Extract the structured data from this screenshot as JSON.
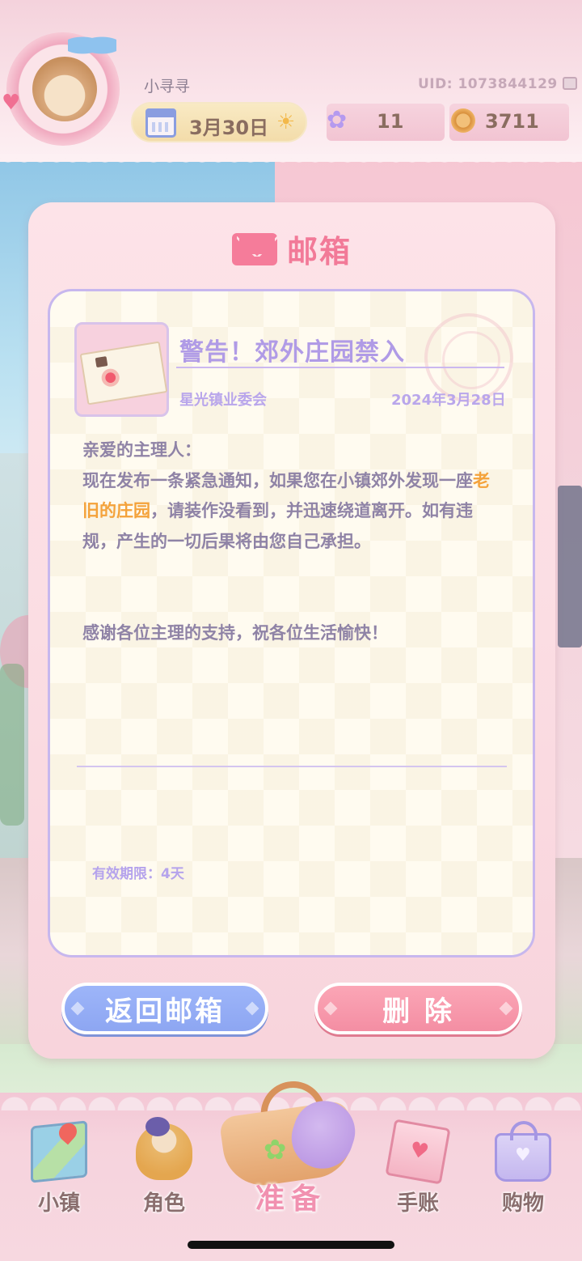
{
  "header": {
    "username": "小寻寻",
    "uid": "UID: 1073844129",
    "date": "3月30日",
    "gems": "11",
    "coins": "3711"
  },
  "mailbox": {
    "title": "邮箱",
    "subject": "警告！郊外庄园禁入",
    "sender": "星光镇业委会",
    "date": "2024年3月28日",
    "greeting": "亲爱的主理人：",
    "body_before": "现在发布一条紧急通知，如果您在小镇郊外发现一座",
    "body_highlight": "老旧的庄园",
    "body_after": "，请装作没看到，并迅速绕道离开。如有违规，产生的一切后果将由您自己承担。",
    "thanks": "感谢各位主理的支持，祝各位生活愉快！",
    "expiry": "有效期限：4天",
    "back_button": "返回邮箱",
    "delete_button": "删 除"
  },
  "nav": {
    "town": "小镇",
    "character": "角色",
    "prepare": "准备",
    "journal": "手账",
    "shop": "购物"
  },
  "colors": {
    "accent_pink": "#f27a98",
    "accent_lavender": "#b09be6",
    "highlight": "#f4a23a",
    "button_blue": "#8da6f2",
    "button_pink": "#f48ea3"
  },
  "icons": {
    "avatar": "shiba-dog-avatar",
    "calendar": "calendar-icon",
    "sun": "sun-icon",
    "gem": "star-gem-icon",
    "coin": "coin-icon",
    "envelope": "envelope-icon",
    "letter": "letter-thumbnail-icon"
  }
}
